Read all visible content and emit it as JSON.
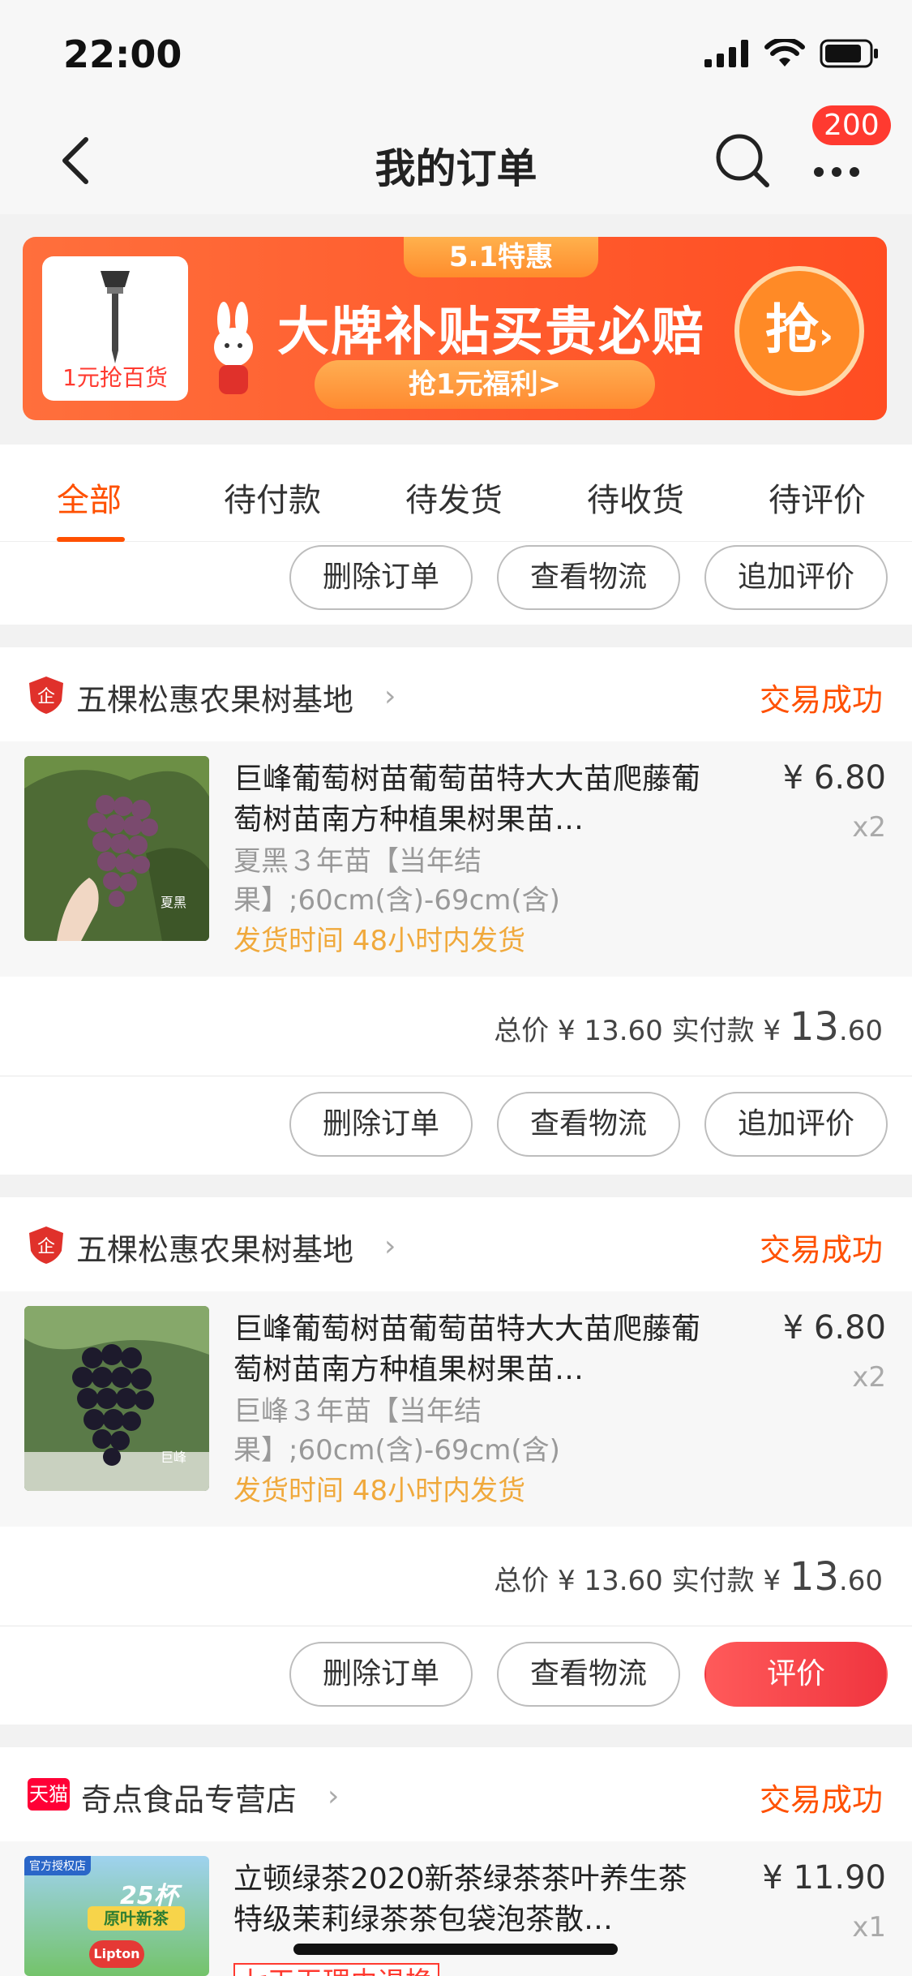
{
  "status_bar": {
    "time": "22:00"
  },
  "nav": {
    "title": "我的订单",
    "badge": "200"
  },
  "promo": {
    "product_label": "1元抢百货",
    "ribbon": "5.1特惠",
    "headline": "大牌补贴买贵必赔",
    "sub": "抢1元福利>",
    "grab": "抢"
  },
  "tabs": [
    {
      "label": "全部"
    },
    {
      "label": "待付款"
    },
    {
      "label": "待发货"
    },
    {
      "label": "待收货"
    },
    {
      "label": "待评价"
    }
  ],
  "actions": {
    "delete": "删除订单",
    "logistics": "查看物流",
    "add_review": "追加评价",
    "review": "评价"
  },
  "orders": [
    {
      "shop": "五棵松惠农果树基地",
      "status": "交易成功",
      "title": "巨峰葡萄树苗葡萄苗特大大苗爬藤葡萄树苗南方种植果树果苗…",
      "sku": "夏黑３年苗【当年结果】;60cm(含)-69cm(含)",
      "ship": "发货时间 48小时内发货",
      "price": "¥ 6.80",
      "qty": "x2",
      "total_label": "总价 ¥ 13.60 实付款 ¥",
      "paid_int": "13",
      "paid_dec": ".60",
      "thumb_label": "夏黑"
    },
    {
      "shop": "五棵松惠农果树基地",
      "status": "交易成功",
      "title": "巨峰葡萄树苗葡萄苗特大大苗爬藤葡萄树苗南方种植果树果苗…",
      "sku": "巨峰３年苗【当年结果】;60cm(含)-69cm(含)",
      "ship": "发货时间 48小时内发货",
      "price": "¥ 6.80",
      "qty": "x2",
      "total_label": "总价 ¥ 13.60 实付款 ¥",
      "paid_int": "13",
      "paid_dec": ".60",
      "thumb_label": "巨峰"
    },
    {
      "shop": "奇点食品专营店",
      "shop_badge": "天猫",
      "status": "交易成功",
      "title": "立顿绿茶2020新茶绿茶茶叶养生茶特级茉莉绿茶茶包袋泡茶散…",
      "price": "¥ 11.90",
      "qty": "x1",
      "refund_tag": "七天无理由退换",
      "thumb_top": "官方授权店",
      "thumb_count": "25杯",
      "thumb_text": "原叶新茶",
      "thumb_brand": "Lipton"
    }
  ]
}
